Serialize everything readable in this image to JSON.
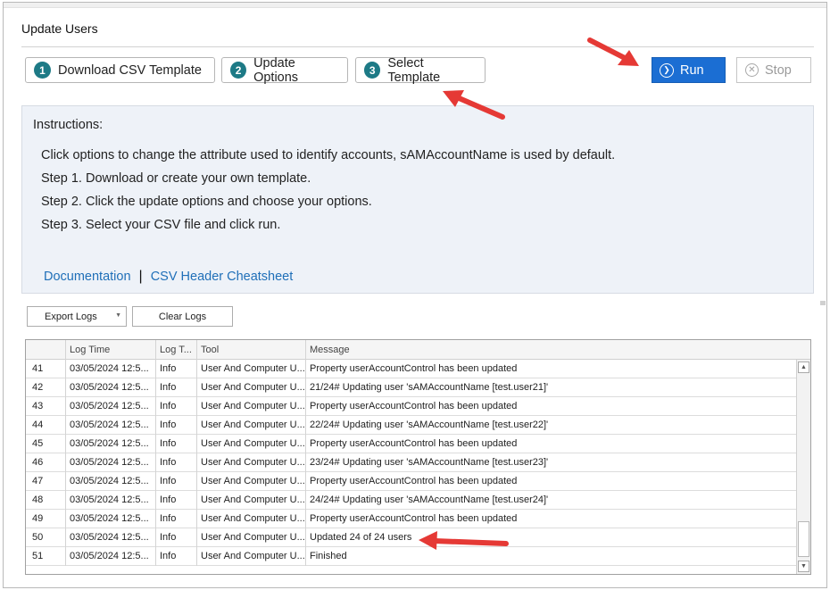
{
  "window": {
    "title": "Update Users"
  },
  "toolbar": {
    "steps": [
      {
        "number": "1",
        "label": "Download CSV Template"
      },
      {
        "number": "2",
        "label": "Update Options"
      },
      {
        "number": "3",
        "label": "Select Template"
      }
    ],
    "run_label": "Run",
    "stop_label": "Stop"
  },
  "instructions": {
    "title": "Instructions:",
    "lines": [
      "Click options to change the attribute used to identify accounts, sAMAccountName is used by default.",
      "Step 1. Download or create your own template.",
      "Step 2. Click the update options and choose your options.",
      "Step 3. Select your CSV file and click run."
    ],
    "links": {
      "documentation": "Documentation",
      "separator": "|",
      "csv_cheatsheet": "CSV Header Cheatsheet"
    }
  },
  "log_toolbar": {
    "export_label": "Export Logs",
    "clear_label": "Clear Logs"
  },
  "log_table": {
    "columns": [
      "",
      "Log Time",
      "Log T...",
      "Tool",
      "Message"
    ],
    "rows": [
      {
        "num": "41",
        "time": "03/05/2024 12:5...",
        "type": "Info",
        "tool": "User And Computer U...",
        "message": " Property userAccountControl has been updated"
      },
      {
        "num": "42",
        "time": "03/05/2024 12:5...",
        "type": "Info",
        "tool": "User And Computer U...",
        "message": "21/24# Updating user 'sAMAccountName [test.user21]'"
      },
      {
        "num": "43",
        "time": "03/05/2024 12:5...",
        "type": "Info",
        "tool": "User And Computer U...",
        "message": " Property userAccountControl has been updated"
      },
      {
        "num": "44",
        "time": "03/05/2024 12:5...",
        "type": "Info",
        "tool": "User And Computer U...",
        "message": "22/24# Updating user 'sAMAccountName [test.user22]'"
      },
      {
        "num": "45",
        "time": "03/05/2024 12:5...",
        "type": "Info",
        "tool": "User And Computer U...",
        "message": " Property userAccountControl has been updated"
      },
      {
        "num": "46",
        "time": "03/05/2024 12:5...",
        "type": "Info",
        "tool": "User And Computer U...",
        "message": "23/24# Updating user 'sAMAccountName [test.user23]'"
      },
      {
        "num": "47",
        "time": "03/05/2024 12:5...",
        "type": "Info",
        "tool": "User And Computer U...",
        "message": " Property userAccountControl has been updated"
      },
      {
        "num": "48",
        "time": "03/05/2024 12:5...",
        "type": "Info",
        "tool": "User And Computer U...",
        "message": "24/24# Updating user 'sAMAccountName [test.user24]'"
      },
      {
        "num": "49",
        "time": "03/05/2024 12:5...",
        "type": "Info",
        "tool": "User And Computer U...",
        "message": " Property userAccountControl has been updated"
      },
      {
        "num": "50",
        "time": "03/05/2024 12:5...",
        "type": "Info",
        "tool": "User And Computer U...",
        "message": "Updated 24 of 24 users"
      },
      {
        "num": "51",
        "time": "03/05/2024 12:5...",
        "type": "Info",
        "tool": "User And Computer U...",
        "message": "Finished"
      }
    ]
  },
  "icons": {
    "step_badge": "numbered-circle-icon",
    "run": "play-circle-icon",
    "stop": "x-circle-icon",
    "export_dropdown": "chevron-down-icon"
  },
  "colors": {
    "step_badge": "#1d7a86",
    "run_button": "#1b6ed3",
    "link": "#1f6fb8",
    "instructions_bg": "#eef2f8",
    "annotation_arrow": "#e53935"
  }
}
